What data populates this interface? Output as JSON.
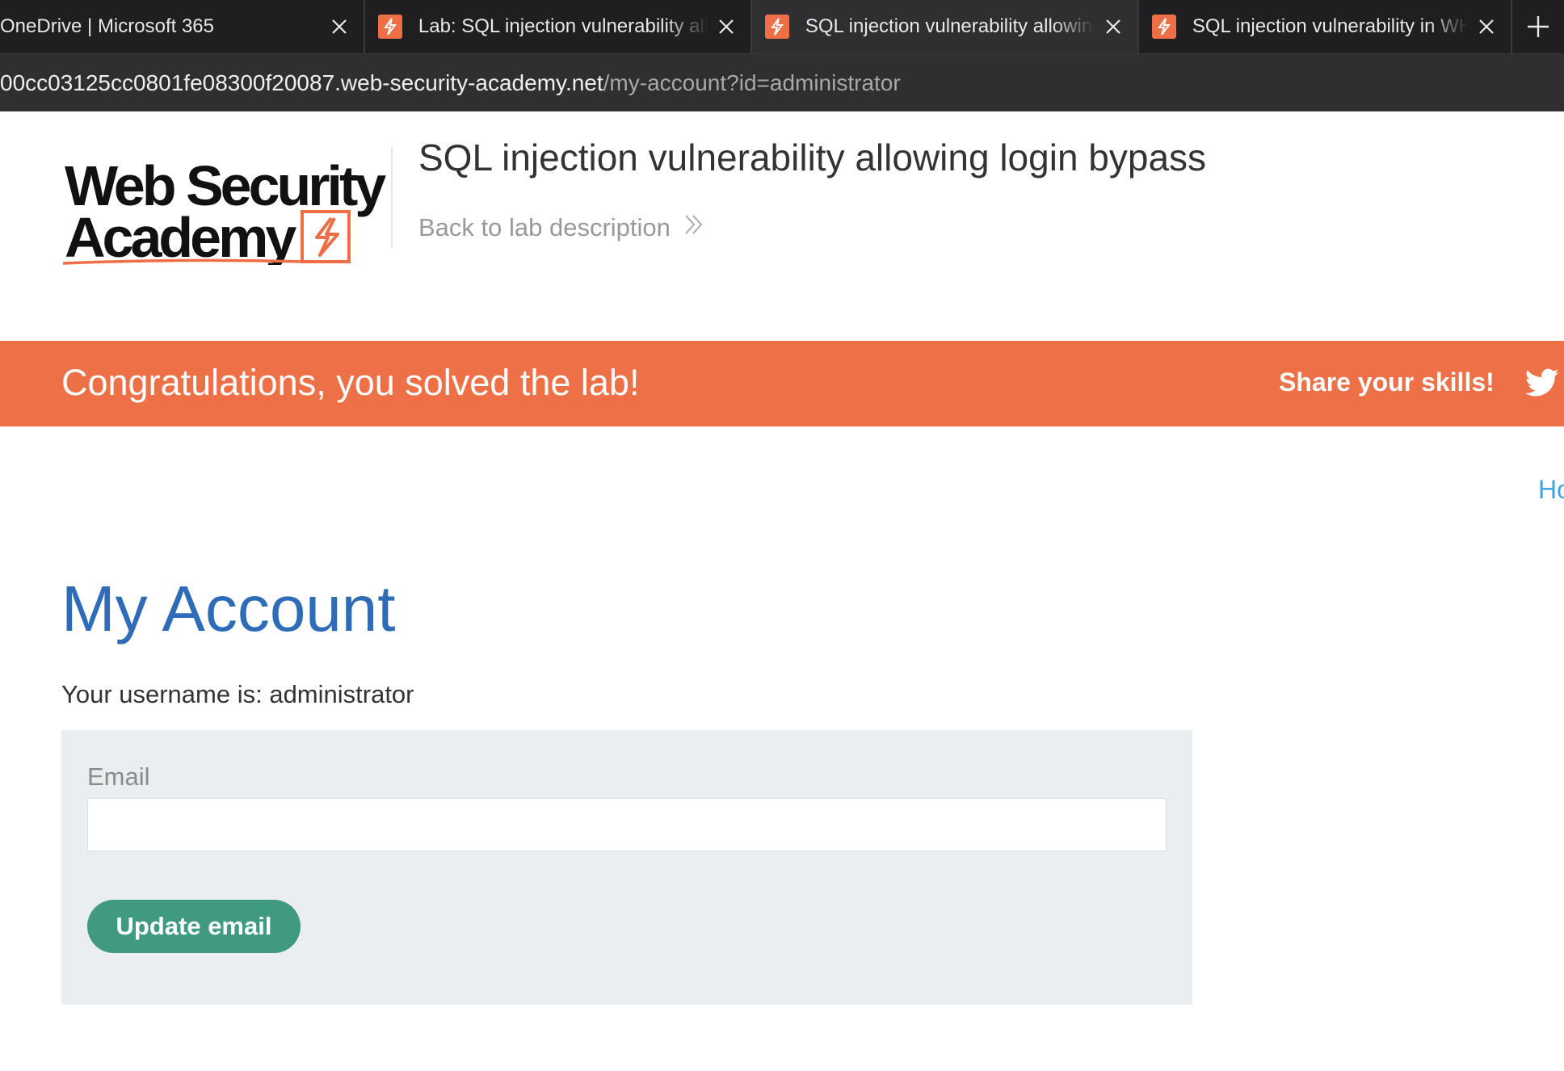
{
  "browser": {
    "tabs": [
      {
        "title": "OneDrive | Microsoft 365",
        "active": false
      },
      {
        "title": "Lab: SQL injection vulnerability allowing login bypass",
        "active": false
      },
      {
        "title": "SQL injection vulnerability allowing login bypass",
        "active": true
      },
      {
        "title": "SQL injection vulnerability in WHERE clause",
        "active": false
      }
    ],
    "new_tab_icon": "plus-icon",
    "address": {
      "host": "00cc03125cc0801fe08300f20087.web-security-academy.net",
      "path": "/my-account?id=administrator"
    }
  },
  "header": {
    "logo_text_line1": "Web Security",
    "logo_text_line2": "Academy",
    "lab_title": "SQL injection vulnerability allowing login bypass",
    "back_link": "Back to lab description"
  },
  "banner": {
    "message": "Congratulations, you solved the lab!",
    "share_label": "Share your skills!",
    "share_icon": "twitter-icon"
  },
  "nav": {
    "home_link": "Home"
  },
  "main": {
    "heading": "My Account",
    "username_text": "Your username is: administrator",
    "form": {
      "email_label": "Email",
      "email_value": "",
      "submit_label": "Update email"
    }
  },
  "colors": {
    "banner": "#ee7046",
    "heading": "#2e6cb8",
    "button": "#3f9a7f",
    "panel": "#ebeef1",
    "link": "#3fa4e4"
  }
}
